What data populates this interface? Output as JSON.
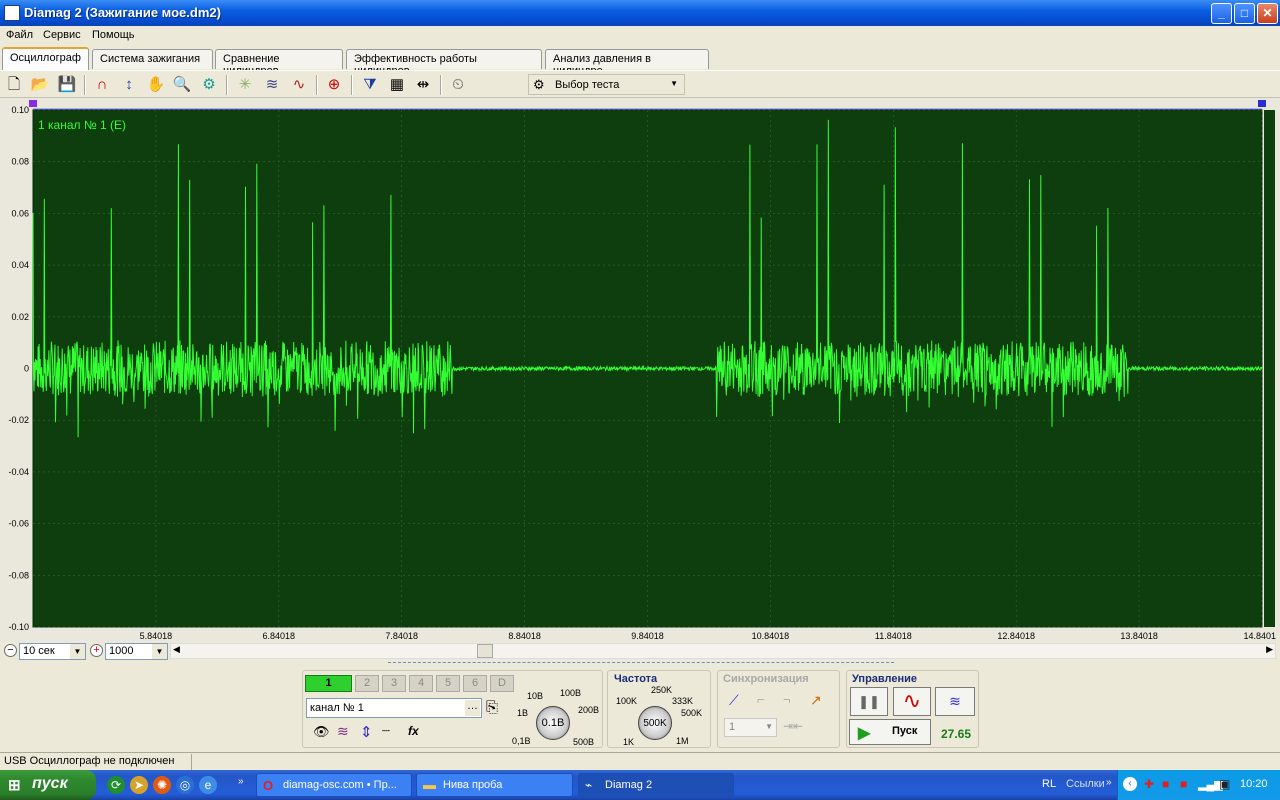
{
  "window": {
    "title": "Diamag 2 (Зажигание мое.dm2)",
    "minimize": "_",
    "maximize": "□",
    "close": "✕"
  },
  "menu": [
    "Файл",
    "Сервис",
    "Помощь"
  ],
  "tabs": [
    "Осциллограф",
    "Система зажигания",
    "Сравнение цилиндров",
    "Эффективность работы цилиндров",
    "Анализ давления в цилиндре"
  ],
  "toolbar": {
    "test_select": "Выбор теста"
  },
  "chart_data": {
    "type": "line",
    "series_label": "1 канал № 1 (Е)",
    "y_ticks": [
      "0.10",
      "0.08",
      "0.06",
      "0.04",
      "0.02",
      "0",
      "-0.02",
      "-0.04",
      "-0.06",
      "-0.08",
      "-0.10"
    ],
    "ylim": [
      -0.1,
      0.1
    ],
    "x_ticks": [
      "5.84018",
      "6.84018",
      "7.84018",
      "8.84018",
      "9.84018",
      "10.84018",
      "11.84018",
      "12.84018",
      "13.84018",
      "14.8401"
    ],
    "x_range": [
      4.84,
      14.84
    ],
    "line_color": "#33ff33",
    "background_color": "#0e3d0e",
    "bursts": [
      {
        "x_start": 4.84,
        "x_end": 8.25,
        "peak": 0.1,
        "noise": 0.015,
        "period": 0.091
      },
      {
        "x_start": 10.4,
        "x_end": 13.75,
        "peak": 0.1,
        "noise": 0.015,
        "period": 0.091
      }
    ],
    "grid": true
  },
  "scroll": {
    "time_scale": "10 сек",
    "points": "1000"
  },
  "channels": {
    "buttons": [
      "1",
      "2",
      "3",
      "4",
      "5",
      "6",
      "D"
    ],
    "name": "канал № 1"
  },
  "amplitude": {
    "value": "0.1В",
    "ticks": [
      "1В",
      "10В",
      "100В",
      "200В",
      "500В",
      "0,1В"
    ]
  },
  "frequency": {
    "title": "Частота",
    "value": "500K",
    "ticks": [
      "100K",
      "250K",
      "333K",
      "500K",
      "1M",
      "1K"
    ]
  },
  "sync": {
    "title": "Синхронизация",
    "channel": "1"
  },
  "control": {
    "title": "Управление",
    "start": "Пуск",
    "readout": "27.65"
  },
  "status": "USB Осциллограф не подключен",
  "taskbar": {
    "start": "пуск",
    "items": [
      "diamag-osc.com • Пр...",
      "Нива проба",
      "Diamag 2"
    ],
    "tray_lang": "RL",
    "tray_links": "Ссылки",
    "time": "10:20"
  }
}
